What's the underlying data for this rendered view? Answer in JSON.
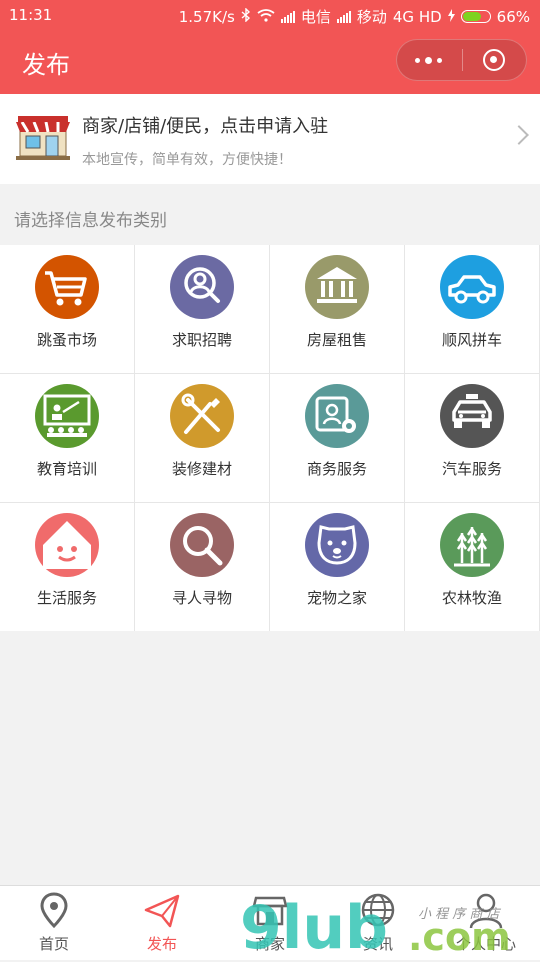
{
  "status_bar": {
    "time": "11:31",
    "network_speed": "1.57K/s",
    "carrier1": "电信",
    "carrier2": "移动",
    "network_type": "4G HD",
    "battery": "66%",
    "battery_level": 0.66
  },
  "header": {
    "title": "发布",
    "bg_color": "#f25555"
  },
  "banner": {
    "title": "商家/店铺/便民，点击申请入驻",
    "subtitle": "本地宣传，简单有效，方便快捷！"
  },
  "section_title": "请选择信息发布类别",
  "categories": [
    {
      "label": "跳蚤市场",
      "icon": "cart-icon",
      "color": "#d35400"
    },
    {
      "label": "求职招聘",
      "icon": "person-search-icon",
      "color": "#6b6aa3"
    },
    {
      "label": "房屋租售",
      "icon": "bank-icon",
      "color": "#999a6a"
    },
    {
      "label": "顺风拼车",
      "icon": "car-icon",
      "color": "#1e9fe0"
    },
    {
      "label": "教育培训",
      "icon": "classroom-icon",
      "color": "#5a9a2e"
    },
    {
      "label": "装修建材",
      "icon": "tools-icon",
      "color": "#d09a2c"
    },
    {
      "label": "商务服务",
      "icon": "id-gear-icon",
      "color": "#5a9a98"
    },
    {
      "label": "汽车服务",
      "icon": "taxi-icon",
      "color": "#555555"
    },
    {
      "label": "生活服务",
      "icon": "smile-house-icon",
      "color": "#f06b6b"
    },
    {
      "label": "寻人寻物",
      "icon": "magnifier-icon",
      "color": "#9a6464"
    },
    {
      "label": "宠物之家",
      "icon": "dog-icon",
      "color": "#6468a8"
    },
    {
      "label": "农林牧渔",
      "icon": "wheat-icon",
      "color": "#5a9a5a"
    }
  ],
  "tabs": [
    {
      "label": "首页",
      "icon": "location-pin-icon"
    },
    {
      "label": "发布",
      "icon": "paper-plane-icon"
    },
    {
      "label": "商家",
      "icon": "shop-icon"
    },
    {
      "label": "资讯",
      "icon": "globe-icon"
    },
    {
      "label": "个人中心",
      "icon": "user-icon"
    }
  ],
  "active_tab": "发布",
  "watermark": {
    "text_main": "9lub",
    "text_domain": ".com",
    "text_script": "小程序商店"
  }
}
